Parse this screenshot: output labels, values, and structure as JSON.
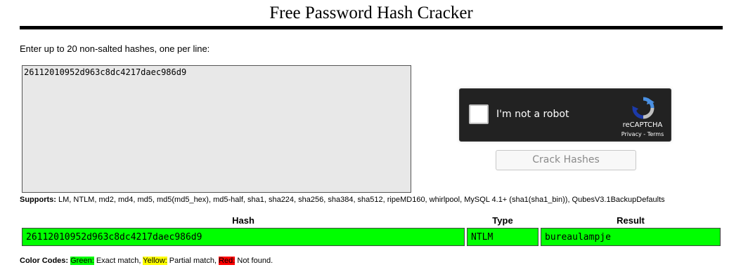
{
  "page": {
    "title": "Free Password Hash Cracker",
    "instructions": "Enter up to 20 non-salted hashes, one per line:"
  },
  "input": {
    "value": "26112010952d963c8dc4217daec986d9"
  },
  "recaptcha": {
    "label": "I'm not a robot",
    "brand": "reCAPTCHA",
    "privacy": "Privacy",
    "separator": " - ",
    "terms": "Terms"
  },
  "button": {
    "label": "Crack Hashes"
  },
  "supports": {
    "label": "Supports:",
    "list": " LM, NTLM, md2, md4, md5, md5(md5_hex), md5-half, sha1, sha224, sha256, sha384, sha512, ripeMD160, whirlpool, MySQL 4.1+ (sha1(sha1_bin)), QubesV3.1BackupDefaults"
  },
  "results": {
    "headers": [
      "Hash",
      "Type",
      "Result"
    ],
    "rows": [
      {
        "hash": "26112010952d963c8dc4217daec986d9",
        "type": "NTLM",
        "result": "bureaulampje",
        "status_color": "#00ff00"
      }
    ]
  },
  "color_codes": {
    "label": "Color Codes:",
    "green": "Green:",
    "green_desc": " Exact match, ",
    "yellow": "Yellow:",
    "yellow_desc": " Partial match, ",
    "red": "Red:",
    "red_desc": " Not found."
  },
  "colors": {
    "exact": "#00ff00",
    "partial": "#ffff00",
    "not_found": "#ff0000",
    "recaptcha_bg": "#222222"
  },
  "icons": {
    "recaptcha_logo": "recaptcha-logo-icon"
  }
}
